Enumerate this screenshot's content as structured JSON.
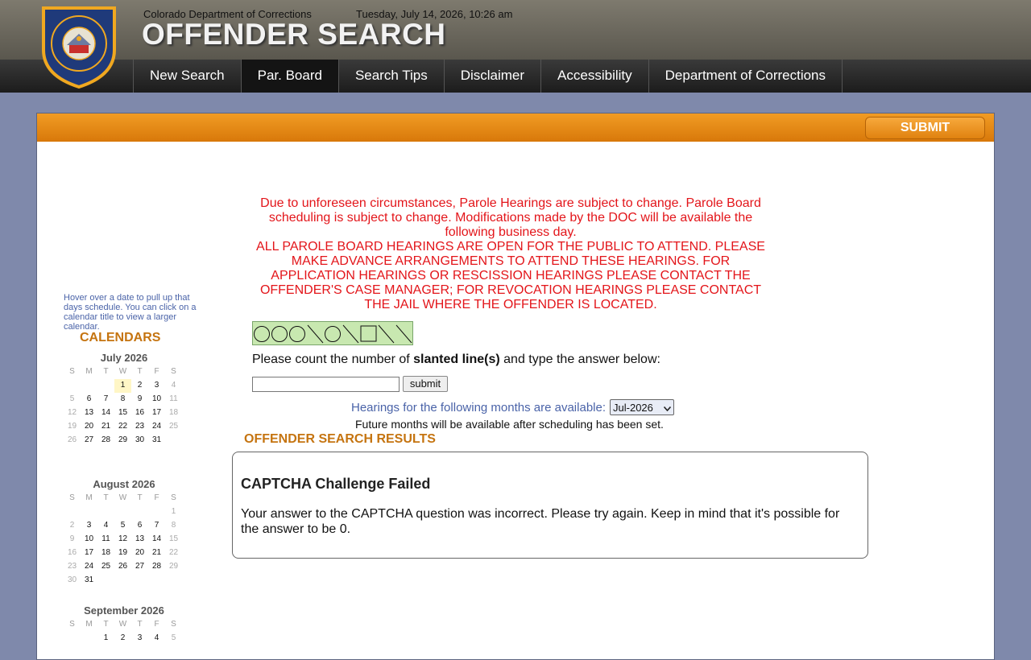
{
  "header": {
    "org_name": "Colorado Department of Corrections",
    "datetime": "Tuesday, July 14, 2026, 10:26 am",
    "title": "OFFENDER SEARCH",
    "logo_text": "COLORADO DEPARTMENT OF CORRECTIONS"
  },
  "nav": {
    "items": [
      {
        "label": "New Search"
      },
      {
        "label": "Par. Board",
        "active": true
      },
      {
        "label": "Search Tips"
      },
      {
        "label": "Disclaimer"
      },
      {
        "label": "Accessibility"
      },
      {
        "label": "Department of Corrections"
      }
    ]
  },
  "toolbar": {
    "submit_label": "SUBMIT"
  },
  "notice": {
    "line1": "Due to unforeseen circumstances, Parole Hearings are subject to change. Parole Board scheduling is subject to change. Modifications made by the DOC will be available the following business day.",
    "line2": "ALL PAROLE BOARD HEARINGS ARE OPEN FOR THE PUBLIC TO ATTEND. PLEASE MAKE ADVANCE ARRANGEMENTS TO ATTEND THESE HEARINGS. FOR APPLICATION HEARINGS OR RESCISSION HEARINGS PLEASE CONTACT THE OFFENDER'S CASE MANAGER; FOR REVOCATION HEARINGS PLEASE CONTACT THE JAIL WHERE THE OFFENDER IS LOCATED."
  },
  "captcha": {
    "question_prefix": "Please count the number of ",
    "question_bold": "slanted line(s)",
    "question_suffix": " and type the answer below:",
    "input_value": "",
    "submit_label": "submit",
    "shapes": [
      "circle",
      "circle",
      "circle",
      "slash",
      "circle",
      "slash",
      "square",
      "slash",
      "slash"
    ]
  },
  "months": {
    "label": "Hearings for the following months are available:",
    "selected": "Jul-2026",
    "note": "Future months will be available after scheduling has been set."
  },
  "results": {
    "title": "OFFENDER SEARCH RESULTS",
    "fail_title": "CAPTCHA Challenge Failed",
    "fail_message": "Your answer to the CAPTCHA question was incorrect. Please try again. Keep in mind that it's possible for the answer to be 0."
  },
  "calendars": {
    "help_text": "Hover over a date to pull up that days schedule. You can click on a calendar title to view a larger calendar.",
    "heading": "CALENDARS",
    "dow": [
      "S",
      "M",
      "T",
      "W",
      "T",
      "F",
      "S"
    ],
    "months": [
      {
        "title": "July 2026",
        "weeks": [
          [
            "",
            "",
            "",
            "1",
            "2",
            "3",
            "4"
          ],
          [
            "5",
            "6",
            "7",
            "8",
            "9",
            "10",
            "11"
          ],
          [
            "12",
            "13",
            "14",
            "15",
            "16",
            "17",
            "18"
          ],
          [
            "19",
            "20",
            "21",
            "22",
            "23",
            "24",
            "25"
          ],
          [
            "26",
            "27",
            "28",
            "29",
            "30",
            "31",
            ""
          ]
        ],
        "highlight": "1"
      },
      {
        "title": "August 2026",
        "weeks": [
          [
            "",
            "",
            "",
            "",
            "",
            "",
            "1"
          ],
          [
            "2",
            "3",
            "4",
            "5",
            "6",
            "7",
            "8"
          ],
          [
            "9",
            "10",
            "11",
            "12",
            "13",
            "14",
            "15"
          ],
          [
            "16",
            "17",
            "18",
            "19",
            "20",
            "21",
            "22"
          ],
          [
            "23",
            "24",
            "25",
            "26",
            "27",
            "28",
            "29"
          ],
          [
            "30",
            "31",
            "",
            "",
            "",
            "",
            ""
          ]
        ]
      },
      {
        "title": "September 2026",
        "weeks": [
          [
            "",
            "",
            "1",
            "2",
            "3",
            "4",
            "5"
          ]
        ]
      }
    ]
  }
}
